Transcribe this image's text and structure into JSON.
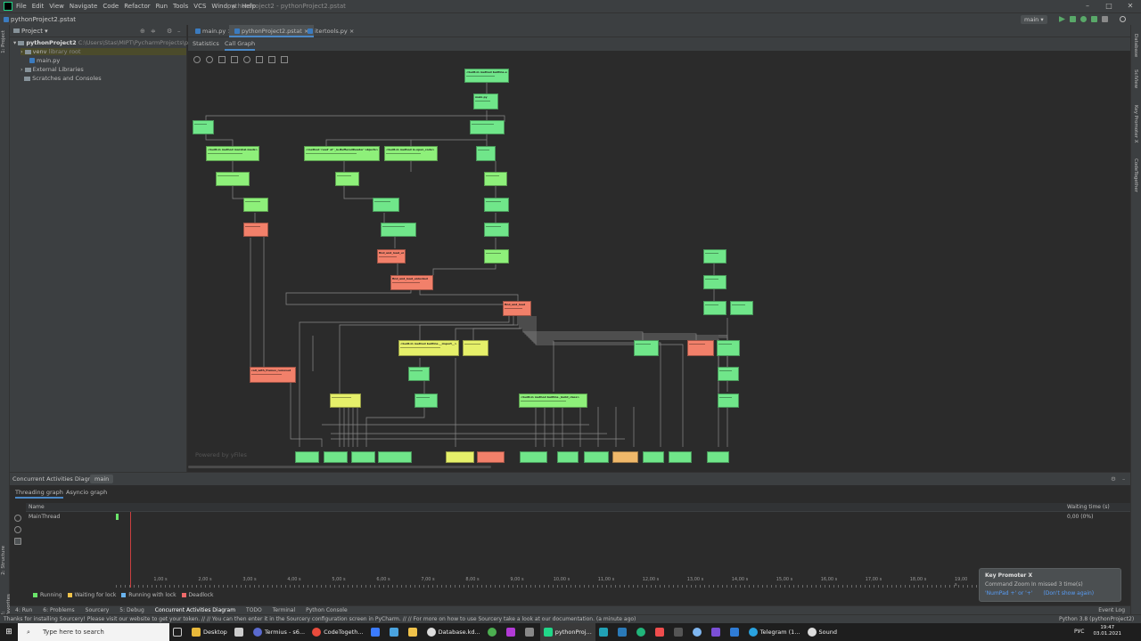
{
  "menu": [
    "File",
    "Edit",
    "View",
    "Navigate",
    "Code",
    "Refactor",
    "Run",
    "Tools",
    "VCS",
    "Window",
    "Help"
  ],
  "window_title": "pythonProject2 - pythonProject2.pstat",
  "breadcrumb": "pythonProject2.pstat",
  "run_config": "main",
  "project_panel": {
    "title": "Project",
    "root_name": "pythonProject2",
    "root_path": "C:\\Users\\Stas\\MIPT\\PycharmProjects\\pythonPro",
    "venv": "venv",
    "venv_note": "library root",
    "main_file": "main.py",
    "external": "External Libraries",
    "scratches": "Scratches and Consoles"
  },
  "editor_tabs": [
    "main.py",
    "pythonProject2.pstat",
    "itertools.py"
  ],
  "profile_tabs": [
    "Statistics",
    "Call Graph"
  ],
  "graph": {
    "powered_by": "Powered by yFiles",
    "node_colors": {
      "green": "#70e68a",
      "red": "#f2806a",
      "yellow": "#e6f06a",
      "orange": "#f0b86a"
    },
    "nodes": [
      {
        "label": "<built-in method builtins.exec>",
        "color": "green"
      },
      {
        "label": "main.py",
        "color": "green"
      },
      {
        "label": "<frozen importlib._bootstrap>",
        "color": "green"
      },
      {
        "label": "<built-in method marshal.loads>",
        "color": "green"
      },
      {
        "label": "<method 'read' of '_io.BufferedReader' objects>",
        "color": "green"
      },
      {
        "label": "<built-in method io.open_code>",
        "color": "lgreen"
      },
      {
        "label": "<frozen importlib._bootstrap_external>",
        "color": "green"
      },
      {
        "label": "find_and_load_unlocked",
        "color": "red"
      },
      {
        "label": "find_and_load",
        "color": "red"
      },
      {
        "label": "call_with_frames_removed",
        "color": "red"
      },
      {
        "label": "<built-in method builtins.__import__>",
        "color": "yellow"
      },
      {
        "label": "<built-in method builtins._build_class>",
        "color": "green"
      }
    ]
  },
  "concurrent": {
    "title": "Concurrent Activities Diagram:",
    "selected": "main",
    "tabs": [
      "Threading graph",
      "Asyncio graph"
    ],
    "col_name": "Name",
    "col_wait": "Waiting time (s)",
    "thread": "MainThread",
    "wait_value": "0,00 (0%)",
    "ticks": [
      "1,00 s",
      "2,00 s",
      "3,00 s",
      "4,00 s",
      "5,00 s",
      "6,00 s",
      "7,00 s",
      "8,00 s",
      "9,00 s",
      "10,00 s",
      "11,00 s",
      "12,00 s",
      "13,00 s",
      "14,00 s",
      "15,00 s",
      "16,00 s",
      "17,00 s",
      "18,00 s",
      "19,00 s"
    ]
  },
  "legend": [
    {
      "label": "Running",
      "color": "#6ae56a"
    },
    {
      "label": "Waiting for lock",
      "color": "#f0c24a"
    },
    {
      "label": "Running with lock",
      "color": "#6ab4f0"
    },
    {
      "label": "Deadlock",
      "color": "#f06a6a"
    }
  ],
  "tool_windows": [
    "4: Run",
    "6: Problems",
    "Sourcery",
    "5: Debug",
    "Concurrent Activities Diagram",
    "TODO",
    "Terminal",
    "Python Console",
    "Event Log"
  ],
  "status": "Thanks for installing Sourcery! Please visit our website to get your token. // // You can then enter it in the Sourcery configuration screen in PyCharm. // // For more on how to use Sourcery take a look at our documentation. (a minute ago)",
  "interpreter": "Python 3.8 (pythonProject2)",
  "key_promoter": {
    "title": "Key Promoter X",
    "message": "Command Zoom In missed 3 time(s)",
    "shortcut": "'NumPad +' or '+'",
    "dismiss": "(Don't show again)"
  },
  "side_tabs_left": [
    "1: Project",
    "2: Structure",
    "2: Favorites"
  ],
  "side_tabs_right": [
    "Database",
    "SciView",
    "Key Promoter X",
    "CodeTogether"
  ],
  "taskbar": {
    "search_placeholder": "Type here to search",
    "items": [
      "Desktop",
      "Termius - s6...",
      "CodeTogeth...",
      "Database.kd...",
      "pythonProj...",
      "Telegram (1...",
      "Sound"
    ],
    "lang": "РУС",
    "time": "19:47",
    "date": "03.01.2021"
  }
}
